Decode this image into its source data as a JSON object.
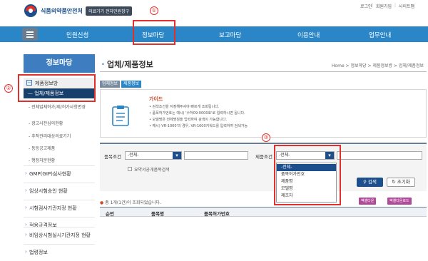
{
  "header": {
    "org_name": "식품의약품안전처",
    "site_name": "의료기기 전자민원창구",
    "util_links": [
      "로그인",
      "회원가입",
      "사이트맵"
    ]
  },
  "nav": {
    "items": [
      "민원신청",
      "정보마당",
      "보고마당",
      "이용안내",
      "업무안내"
    ]
  },
  "sidebar": {
    "title": "정보마당",
    "group_label": "제품정보방",
    "group_toggle": "−",
    "active_item": "— 업체/제품정보",
    "sub_items": [
      "- 전체업체허가/제/허가사항변경",
      "- 광고사전심의현황",
      "- 추적관리대상의료기기",
      "- 동등공고제품",
      "- 행정처분현황"
    ],
    "items": [
      "GMP(GIP)심사현황",
      "임상시험승인 현황",
      "시험검사기관지정 현황",
      "적용규격정보",
      "비임상시험실시기관지정 현황",
      "법령정보"
    ]
  },
  "content": {
    "bullet": "•",
    "title": "업체/제품정보",
    "breadcrumb": "Home > 정보마당 > 제품정보방 > 업체/제품정보",
    "tabs": [
      "업체정보",
      "제품정보"
    ],
    "guide": {
      "heading": "가이드",
      "lines": [
        "• 검색조건을 지정해주셔야 빠르게 조회됩니다.",
        "• 품목허가번호는 예시) '수허09-0000호'로 입력하시면 됩니다.",
        "• 모델명은 전체명칭을 입력하여 검색이 가능합니다.",
        "• 예시) VR-1000'의 경우, VR-1000키워드를 입력하여 검색가능"
      ]
    },
    "search": {
      "item_cond_label": "품목조건",
      "item_cond_value": "-전체-",
      "product_cond_label": "제품조건",
      "product_cond_value": "-전체-",
      "checkbox_label": "요약서공개품목검색",
      "search_button": "검색",
      "reset_button": "초기화",
      "caret": "▾"
    },
    "dropdown": {
      "options": [
        "-전체-",
        "품목허가번호",
        "제품명",
        "모델명",
        "제조자"
      ],
      "selected_index": 0
    },
    "results": {
      "total_text": "총 1개(1건)이 조회되었습니다.",
      "buttons": [
        "엑셀다운",
        "엑셀다운로드"
      ],
      "columns": [
        "순번",
        "품목명",
        "품목허가번호"
      ]
    },
    "annotations": [
      "①",
      "②",
      "③"
    ]
  },
  "colors": {
    "nav_bg": "#2a86c6",
    "primary": "#1d4f8c",
    "annotation": "#e0302c"
  }
}
